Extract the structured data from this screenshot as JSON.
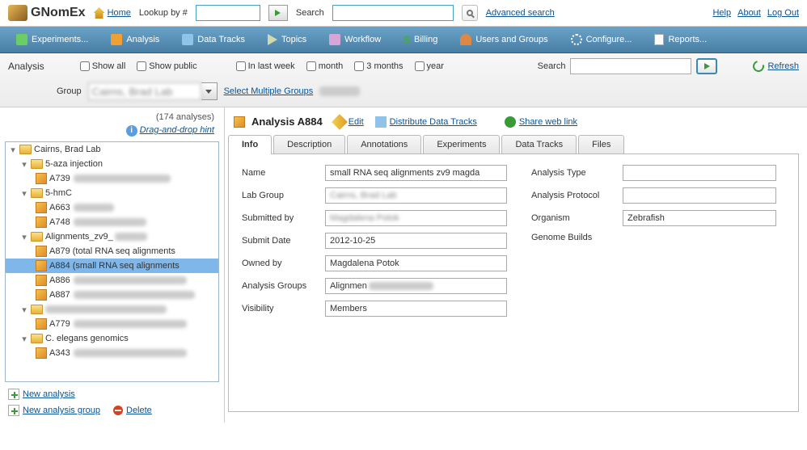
{
  "app": {
    "name": "GNomEx"
  },
  "topbar": {
    "home": "Home",
    "lookup_label": "Lookup by #",
    "search_label": "Search",
    "advanced": "Advanced search",
    "help": "Help",
    "about": "About",
    "logout": "Log Out"
  },
  "nav": {
    "experiments": "Experiments...",
    "analysis": "Analysis",
    "datatracks": "Data Tracks",
    "topics": "Topics",
    "workflow": "Workflow",
    "billing": "Billing",
    "users": "Users and Groups",
    "configure": "Configure...",
    "reports": "Reports..."
  },
  "filter": {
    "title": "Analysis",
    "show_all": "Show all",
    "show_public": "Show public",
    "in_last_week": "In last week",
    "month": "month",
    "three_months": "3 months",
    "year": "year",
    "search_label": "Search",
    "refresh": "Refresh",
    "group_label": "Group",
    "group_value": "Cairns, Brad Lab",
    "select_multiple": "Select Multiple Groups"
  },
  "left": {
    "count_label": "(174 analyses)",
    "dnd_hint": "Drag-and-drop hint",
    "root": "Cairns, Brad Lab",
    "n1": "5-aza injection",
    "n1a": "A739",
    "n2": "5-hmC",
    "n2a": "A663",
    "n2b": "A748",
    "n3": "Alignments_zv9_",
    "n3a": "A879 (total RNA seq alignments",
    "n3b": "A884 (small RNA seq alignments",
    "n3c": "A886",
    "n3d": "A887",
    "n4": "",
    "n4a": "A779",
    "n5": "C. elegans genomics",
    "n5a": "A343",
    "new_analysis": "New analysis",
    "new_group": "New analysis group",
    "delete": "Delete"
  },
  "detail": {
    "title": "Analysis A884",
    "edit": "Edit",
    "distribute": "Distribute Data Tracks",
    "share": "Share web link",
    "tabs": {
      "info": "Info",
      "description": "Description",
      "annotations": "Annotations",
      "experiments": "Experiments",
      "datatracks": "Data Tracks",
      "files": "Files"
    },
    "info": {
      "name_label": "Name",
      "name": "small RNA seq alignments zv9 magda",
      "labgroup_label": "Lab Group",
      "labgroup": "Cairns, Brad Lab",
      "submittedby_label": "Submitted by",
      "submittedby": "Magdalena Potok",
      "submitdate_label": "Submit Date",
      "submitdate": "2012-10-25",
      "ownedby_label": "Owned by",
      "ownedby": "Magdalena Potok",
      "groups_label": "Analysis Groups",
      "groups": "Alignmen",
      "visibility_label": "Visibility",
      "visibility": "Members",
      "type_label": "Analysis Type",
      "type": "",
      "protocol_label": "Analysis Protocol",
      "protocol": "",
      "organism_label": "Organism",
      "organism": "Zebrafish",
      "builds_label": "Genome Builds",
      "builds": ""
    }
  }
}
